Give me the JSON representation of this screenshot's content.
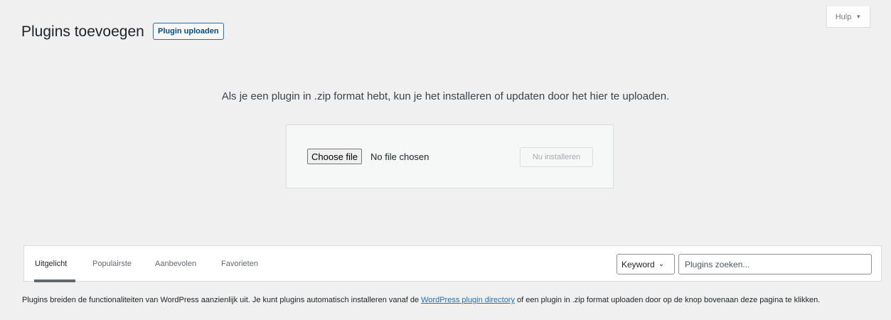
{
  "header": {
    "title": "Plugins toevoegen",
    "upload_button": "Plugin uploaden",
    "help_tab": "Hulp",
    "help_caret": "▼"
  },
  "upload": {
    "description": "Als je een plugin in .zip format hebt, kun je het installeren of updaten door het hier te uploaden.",
    "choose_file": "Choose file",
    "no_file": "No file chosen",
    "install_button": "Nu installeren"
  },
  "filter": {
    "tabs": [
      {
        "label": "Uitgelicht",
        "active": true
      },
      {
        "label": "Populairste",
        "active": false
      },
      {
        "label": "Aanbevolen",
        "active": false
      },
      {
        "label": "Favorieten",
        "active": false
      }
    ],
    "search_type": "Keyword",
    "search_type_chevron": "⌄",
    "search_placeholder": "Plugins zoeken..."
  },
  "footer": {
    "text_before": "Plugins breiden de functionaliteiten van WordPress aanzienlijk uit. Je kunt plugins automatisch installeren vanaf de ",
    "link": "WordPress plugin directory",
    "text_after": " of een plugin in .zip format uploaden door op de knop bovenaan deze pagina te klikken."
  },
  "colors": {
    "background": "#f0f0f1",
    "accent": "#2271b1",
    "text": "#1d2327"
  }
}
